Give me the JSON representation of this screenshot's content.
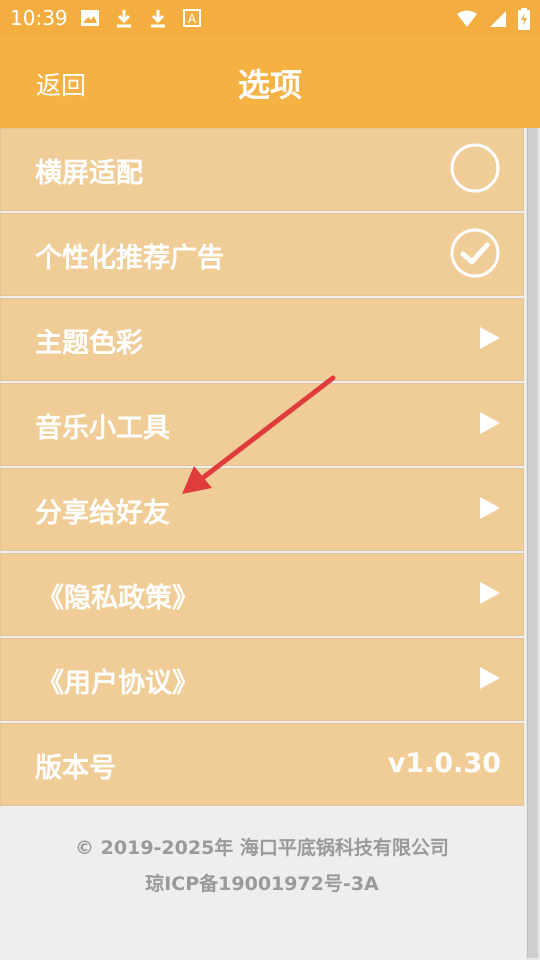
{
  "status": {
    "time": "10:39"
  },
  "header": {
    "back_label": "返回",
    "title": "选项"
  },
  "items": [
    {
      "label": "横屏适配",
      "control": "checkbox",
      "checked": false
    },
    {
      "label": "个性化推荐广告",
      "control": "checkbox",
      "checked": true
    },
    {
      "label": "主题色彩",
      "control": "chevron"
    },
    {
      "label": "音乐小工具",
      "control": "chevron"
    },
    {
      "label": "分享给好友",
      "control": "chevron"
    },
    {
      "label": "《隐私政策》",
      "control": "chevron"
    },
    {
      "label": "《用户协议》",
      "control": "chevron"
    },
    {
      "label": "版本号",
      "control": "value",
      "value": "v1.0.30"
    }
  ],
  "footer": {
    "copyright": "© 2019-2025年 海口平底锅科技有限公司",
    "icp": "琼ICP备19001972号-3A"
  },
  "colors": {
    "appbar": "#f6b143",
    "row_bg": "#f0cd97",
    "annotation_arrow": "#e03c3c"
  }
}
